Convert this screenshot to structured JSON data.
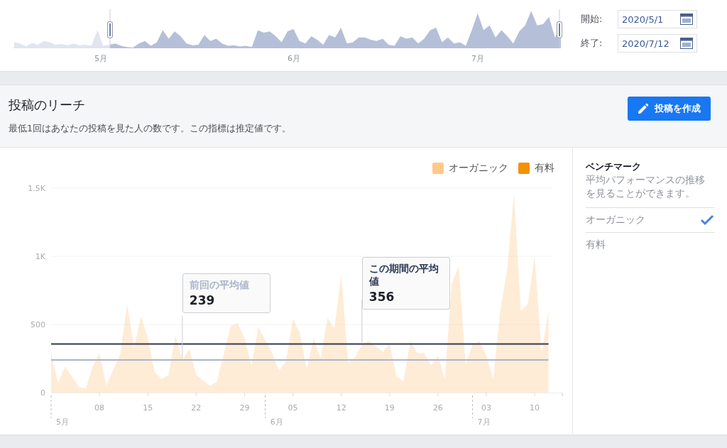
{
  "overview": {
    "months": [
      "5月",
      "6月",
      "7月"
    ],
    "start_label": "開始:",
    "start_value": "2020/5/1",
    "end_label": "終了:",
    "end_value": "2020/7/12"
  },
  "reach": {
    "title": "投稿のリーチ",
    "subtitle": "最低1回はあなたの投稿を見た人の数です。この指標は推定値です。",
    "create_button": "投稿を作成",
    "legend_extra": [
      {
        "label": "有料",
        "color": "#f59000"
      }
    ],
    "month_labels": [
      "5月",
      "6月",
      "7月"
    ],
    "averages": [
      {
        "value": "239"
      },
      {
        "value": "356"
      }
    ],
    "chart_data": {
      "type": "area",
      "yticks": [
        {
          "value": 0,
          "label": "0"
        },
        {
          "value": 500,
          "label": "500"
        },
        {
          "value": 1000,
          "label": "1K"
        },
        {
          "value": 1500,
          "label": "1.5K"
        }
      ],
      "ylim": [
        0,
        1500
      ],
      "x": [
        "2020-05-01",
        "2020-05-02",
        "2020-05-03",
        "2020-05-04",
        "2020-05-05",
        "2020-05-06",
        "2020-05-07",
        "2020-05-08",
        "2020-05-09",
        "2020-05-10",
        "2020-05-11",
        "2020-05-12",
        "2020-05-13",
        "2020-05-14",
        "2020-05-15",
        "2020-05-16",
        "2020-05-17",
        "2020-05-18",
        "2020-05-19",
        "2020-05-20",
        "2020-05-21",
        "2020-05-22",
        "2020-05-23",
        "2020-05-24",
        "2020-05-25",
        "2020-05-26",
        "2020-05-27",
        "2020-05-28",
        "2020-05-29",
        "2020-05-30",
        "2020-05-31",
        "2020-06-01",
        "2020-06-02",
        "2020-06-03",
        "2020-06-04",
        "2020-06-05",
        "2020-06-06",
        "2020-06-07",
        "2020-06-08",
        "2020-06-09",
        "2020-06-10",
        "2020-06-11",
        "2020-06-12",
        "2020-06-13",
        "2020-06-14",
        "2020-06-15",
        "2020-06-16",
        "2020-06-17",
        "2020-06-18",
        "2020-06-19",
        "2020-06-20",
        "2020-06-21",
        "2020-06-22",
        "2020-06-23",
        "2020-06-24",
        "2020-06-25",
        "2020-06-26",
        "2020-06-27",
        "2020-06-28",
        "2020-06-29",
        "2020-06-30",
        "2020-07-01",
        "2020-07-02",
        "2020-07-03",
        "2020-07-04",
        "2020-07-05",
        "2020-07-06",
        "2020-07-07",
        "2020-07-08",
        "2020-07-09",
        "2020-07-10",
        "2020-07-11",
        "2020-07-12"
      ],
      "xlim": [
        "2020-05-01",
        "2020-07-14"
      ],
      "xticks": [
        {
          "value": "2020-05-08",
          "label": "08"
        },
        {
          "value": "2020-05-15",
          "label": "15"
        },
        {
          "value": "2020-05-22",
          "label": "22"
        },
        {
          "value": "2020-05-29",
          "label": "29"
        },
        {
          "value": "2020-06-05",
          "label": "05"
        },
        {
          "value": "2020-06-12",
          "label": "12"
        },
        {
          "value": "2020-06-19",
          "label": "19"
        },
        {
          "value": "2020-06-26",
          "label": "26"
        },
        {
          "value": "2020-07-03",
          "label": "03"
        },
        {
          "value": "2020-07-10",
          "label": "10"
        }
      ],
      "series": [
        {
          "name": "オーガニック",
          "type": "area",
          "color": "#ffc98a",
          "values": [
            290,
            70,
            190,
            120,
            40,
            30,
            190,
            290,
            50,
            170,
            280,
            650,
            330,
            560,
            400,
            150,
            100,
            130,
            420,
            240,
            320,
            130,
            90,
            50,
            80,
            null,
            490,
            510,
            400,
            200,
            480,
            null,
            290,
            160,
            230,
            540,
            440,
            170,
            400,
            250,
            550,
            470,
            870,
            220,
            260,
            350,
            380,
            340,
            300,
            360,
            120,
            80,
            380,
            290,
            290,
            200,
            270,
            100,
            800,
            930,
            210,
            350,
            380,
            270,
            100,
            600,
            900,
            1460,
            600,
            650,
            1000,
            290,
            600
          ]
        },
        {
          "name": "前回の平均値",
          "type": "line",
          "color": "#aab4cc",
          "values": [
            239,
            239,
            239,
            239,
            239,
            239,
            239,
            239,
            239,
            239,
            239,
            239,
            239,
            239,
            239,
            239,
            239,
            239,
            239,
            239,
            239,
            239,
            239,
            239,
            239,
            239,
            239,
            239,
            239,
            239,
            239,
            239,
            239,
            239,
            239,
            239,
            239,
            239,
            239,
            239,
            239,
            239,
            239,
            239,
            239,
            239,
            239,
            239,
            239,
            239,
            239,
            239,
            239,
            239,
            239,
            239,
            239,
            239,
            239,
            239,
            239,
            239,
            239,
            239,
            239,
            239,
            239,
            239,
            239,
            239,
            239,
            239,
            239
          ]
        },
        {
          "name": "この期間の平均値",
          "type": "line",
          "color": "#2d3a55",
          "values": [
            356,
            356,
            356,
            356,
            356,
            356,
            356,
            356,
            356,
            356,
            356,
            356,
            356,
            356,
            356,
            356,
            356,
            356,
            356,
            356,
            356,
            356,
            356,
            356,
            356,
            356,
            356,
            356,
            356,
            356,
            356,
            356,
            356,
            356,
            356,
            356,
            356,
            356,
            356,
            356,
            356,
            356,
            356,
            356,
            356,
            356,
            356,
            356,
            356,
            356,
            356,
            356,
            356,
            356,
            356,
            356,
            356,
            356,
            356,
            356,
            356,
            356,
            356,
            356,
            356,
            356,
            356,
            356,
            356,
            356,
            356,
            356,
            356
          ]
        }
      ]
    },
    "benchmark": {
      "title": "ベンチマーク",
      "description": "平均パフォーマンスの推移を見ることができます。",
      "options": [
        {
          "label": "オーガニック",
          "checked": true
        },
        {
          "label": "有料",
          "checked": false
        }
      ]
    }
  }
}
